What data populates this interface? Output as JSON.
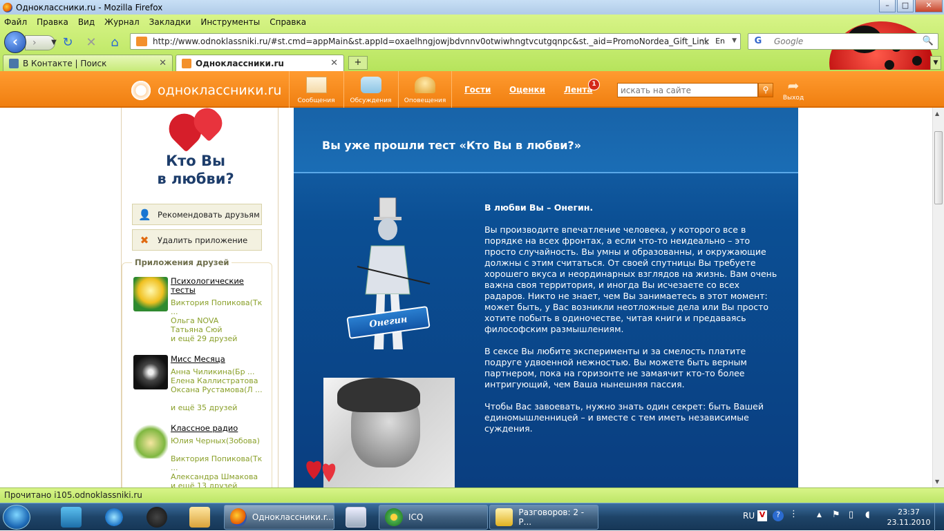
{
  "window": {
    "title": "Одноклассники.ru - Mozilla Firefox",
    "min": "–",
    "max": "□",
    "close": "✕"
  },
  "menu": [
    "Файл",
    "Правка",
    "Вид",
    "Журнал",
    "Закладки",
    "Инструменты",
    "Справка"
  ],
  "nav": {
    "url": "http://www.odnoklassniki.ru/#st.cmd=appMain&st.appId=oxaelhngjowjbdvnnv0otwiwhngtvcutgqnpc&st._aid=PromoNordea_Gift_Link",
    "lang": "En",
    "search_placeholder": "Google"
  },
  "tabs": [
    {
      "label": "В Контакте | Поиск",
      "color": "#4a76a8"
    },
    {
      "label": "Одноклассники.ru",
      "color": "#f3902c"
    }
  ],
  "header": {
    "logo": "одноклассники.ru",
    "buttons": [
      "Сообщения",
      "Обсуждения",
      "Оповещения"
    ],
    "links": [
      "Гости",
      "Оценки",
      "Лента"
    ],
    "feed_badge": "1",
    "search_placeholder": "искать на сайте",
    "logout": "Выход"
  },
  "sidebar": {
    "app_title_line1": "Кто Вы",
    "app_title_line2": "в любви?",
    "recommend": "Рекомендовать друзьям",
    "remove": "Удалить приложение",
    "friends_apps_title": "Приложения друзей",
    "apps": [
      {
        "name": "Психологические тесты",
        "friends": [
          "Виктория Попикова(Тк ...",
          "Ольга NOVA",
          "Татьяна Сюй",
          "и ещё 29 друзей"
        ]
      },
      {
        "name": "Мисс Месяца",
        "friends": [
          "Анна Чиликина(Бр ...",
          "Елена Каллистратова",
          "Оксана Рустамова(Л ...",
          "и ещё 35 друзей"
        ]
      },
      {
        "name": "Классное радио",
        "friends": [
          "Юлия Черных(Зобова)",
          "Виктория Попикова(Тк ...",
          "Александра Шмакова",
          "и ещё 13 друзей"
        ]
      }
    ]
  },
  "main": {
    "heading": "Вы уже прошли тест «Кто Вы в любви?»",
    "ribbon": "Онегин",
    "result_title": "В любви Вы – Онегин.",
    "p1": "Вы производите впечатление человека, у которого все в порядке на всех фронтах, а если что-то неидеально – это просто случайность. Вы умны и образованны, и окружающие должны с этим считаться. От своей спутницы Вы требуете хорошего вкуса и неординарных взглядов на жизнь. Вам очень важна своя территория, и иногда Вы исчезаете со всех радаров. Никто не знает, чем Вы занимаетесь в этот момент: может быть, у Вас возникли неотложные дела или Вы просто хотите побыть в одиночестве, читая книги и предаваясь философским размышлениям.",
    "p2": "В сексе Вы любите эксперименты и за смелость платите подруге удвоенной нежностью. Вы можете быть верным партнером, пока на горизонте не замаячит кто-то более интригующий, чем Ваша нынешняя пассия.",
    "p3": "Чтобы Вас завоевать, нужно знать один секрет: быть Вашей единомышленницей – и вместе с тем иметь независимые суждения."
  },
  "status": "Прочитано i105.odnoklassniki.ru",
  "taskbar": {
    "items": [
      "Одноклассники.r...",
      "ICQ",
      "Разговоров: 2 - Р..."
    ],
    "lang": "RU",
    "time": "23:37",
    "date": "23.11.2010"
  },
  "colors": {
    "ok_orange": "#f07f10",
    "firefox_green": "#b6e45c",
    "panel_blue": "#0b4f94"
  }
}
